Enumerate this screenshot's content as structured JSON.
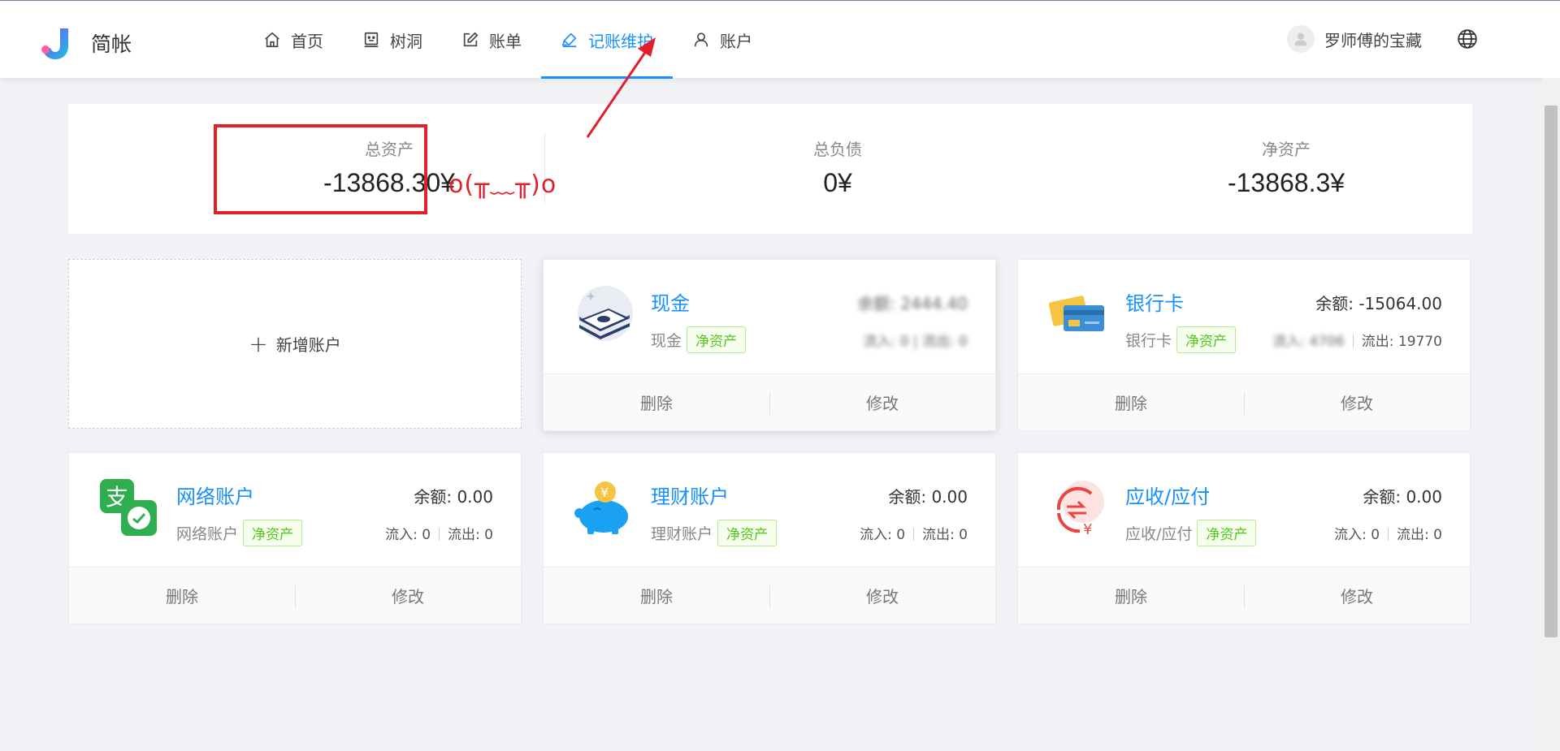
{
  "app": {
    "brand": "简帐"
  },
  "nav": [
    {
      "label": "首页"
    },
    {
      "label": "树洞"
    },
    {
      "label": "账单"
    },
    {
      "label": "记账维护"
    },
    {
      "label": "账户"
    }
  ],
  "user": {
    "name": "罗师傅的宝藏"
  },
  "summary": {
    "total_assets": {
      "label": "总资产",
      "value": "-13868.30¥"
    },
    "total_liabilities": {
      "label": "总负债",
      "value": "0¥"
    },
    "net_assets": {
      "label": "净资产",
      "value": "-13868.3¥"
    }
  },
  "annotation": {
    "emoticon": "o(╥﹏╥)o",
    "color": "#e0202a"
  },
  "add_account": {
    "label": "新增账户"
  },
  "accounts": [
    {
      "title": "现金",
      "type": "现金",
      "tag": "净资产",
      "balance": "余额: 2444.40",
      "flow": "流入: 0 | 流出: 0",
      "blurred": true,
      "delete": "删除",
      "edit": "修改"
    },
    {
      "title": "银行卡",
      "type": "银行卡",
      "tag": "净资产",
      "balance": "余额: -15064.00",
      "inflow": "流入: 4706",
      "outflow": "流出: 19770",
      "delete": "删除",
      "edit": "修改"
    },
    {
      "title": "网络账户",
      "type": "网络账户",
      "tag": "净资产",
      "balance": "余额: 0.00",
      "inflow": "流入: 0",
      "outflow": "流出: 0",
      "delete": "删除",
      "edit": "修改"
    },
    {
      "title": "理财账户",
      "type": "理财账户",
      "tag": "净资产",
      "balance": "余额: 0.00",
      "inflow": "流入: 0",
      "outflow": "流出: 0",
      "delete": "删除",
      "edit": "修改"
    },
    {
      "title": "应收/应付",
      "type": "应收/应付",
      "tag": "净资产",
      "balance": "余额: 0.00",
      "inflow": "流入: 0",
      "outflow": "流出: 0",
      "delete": "删除",
      "edit": "修改"
    }
  ],
  "colors": {
    "accent": "#1890ff",
    "tag_green": "#52c41a",
    "highlight_red": "#e0202a"
  }
}
